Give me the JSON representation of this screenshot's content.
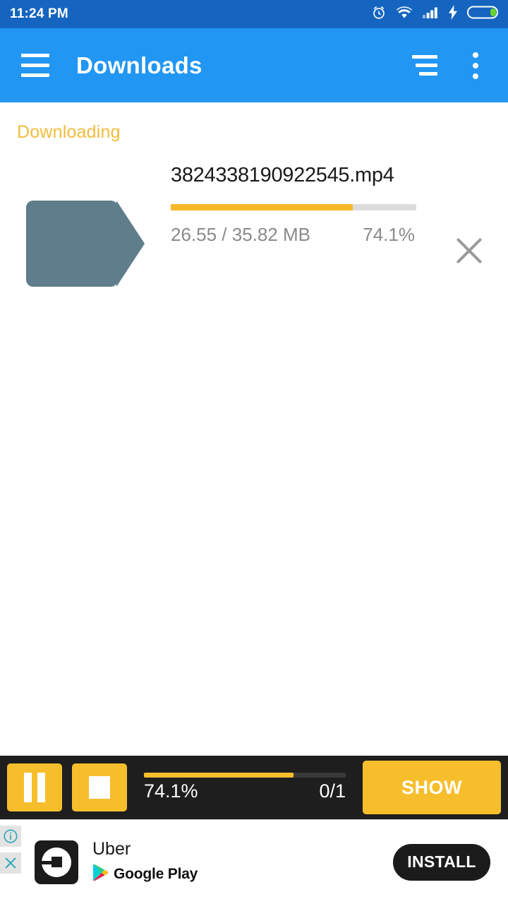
{
  "status_bar": {
    "time": "11:24 PM",
    "icons": [
      "alarm-icon",
      "wifi-icon",
      "signal-icon",
      "charging-bolt-icon",
      "battery-icon"
    ],
    "background_color": "#1565C0"
  },
  "app_bar": {
    "title": "Downloads",
    "menu_icon": "hamburger-icon",
    "sort_icon": "sort-icon",
    "overflow_icon": "overflow-menu-icon",
    "background_color": "#2196F3"
  },
  "content": {
    "section_label": "Downloading",
    "section_label_color": "#F2BC3C",
    "download": {
      "thumbnail_icon": "video-camera-icon",
      "thumbnail_color": "#5F7D8A",
      "file_name": "3824338190922545.mp4",
      "size_text": "26.55 / 35.82 MB",
      "percent_text": "74.1%",
      "progress_percent": 74.1,
      "progress_fill_color": "#F6B82B",
      "progress_track_color": "#DCDCDC",
      "cancel_icon": "close-icon"
    }
  },
  "control_bar": {
    "background_color": "#1E1E1E",
    "accent_color": "#F7BE2C",
    "pause_icon": "pause-icon",
    "stop_icon": "stop-icon",
    "progress_percent": 74.1,
    "percent_text": "74.1%",
    "count_text": "0/1",
    "show_label": "SHOW"
  },
  "ad_banner": {
    "info_icon": "info-icon",
    "close_icon": "close-icon",
    "app_icon": "uber-logo-icon",
    "app_title": "Uber",
    "store_icon": "google-play-icon",
    "store_label": "Google Play",
    "install_label": "INSTALL"
  }
}
